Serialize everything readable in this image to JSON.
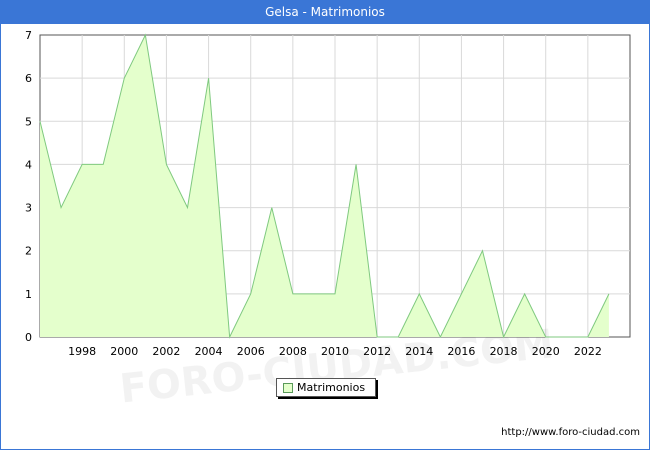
{
  "title": "Gelsa - Matrimonios",
  "legend": {
    "label": "Matrimonios"
  },
  "watermark": "FORO-CIUDAD.COM",
  "source_url": "http://www.foro-ciudad.com",
  "colors": {
    "header": "#3a76d6",
    "area_fill": "#e4ffcc",
    "line": "#7fc97f",
    "grid": "#d9d9d9"
  },
  "chart_data": {
    "type": "area",
    "title": "Gelsa - Matrimonios",
    "xlabel": "",
    "ylabel": "",
    "x": [
      1996,
      1997,
      1998,
      1999,
      2000,
      2001,
      2002,
      2003,
      2004,
      2005,
      2006,
      2007,
      2008,
      2009,
      2010,
      2011,
      2012,
      2013,
      2014,
      2015,
      2016,
      2017,
      2018,
      2019,
      2020,
      2021,
      2022,
      2023
    ],
    "series": [
      {
        "name": "Matrimonios",
        "values": [
          5,
          3,
          4,
          4,
          6,
          7,
          4,
          3,
          6,
          0,
          1,
          3,
          1,
          1,
          1,
          4,
          0,
          0,
          1,
          0,
          1,
          2,
          0,
          1,
          0,
          0,
          0,
          1
        ]
      }
    ],
    "x_ticks": [
      "1998",
      "2000",
      "2002",
      "2004",
      "2006",
      "2008",
      "2010",
      "2012",
      "2014",
      "2016",
      "2018",
      "2020",
      "2022"
    ],
    "y_ticks": [
      "0",
      "1",
      "2",
      "3",
      "4",
      "5",
      "6",
      "7"
    ],
    "xlim": [
      1996,
      2024
    ],
    "ylim": [
      0,
      7
    ],
    "grid": true,
    "legend_position": "bottom-center"
  }
}
